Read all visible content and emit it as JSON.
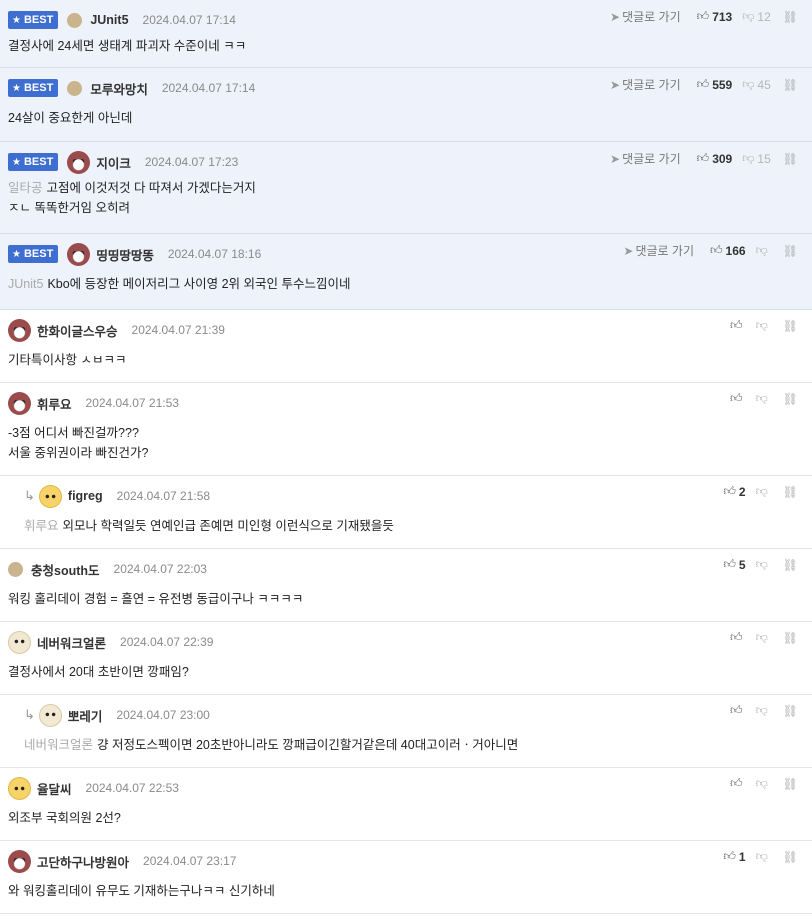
{
  "labels": {
    "best": "BEST",
    "goto": "댓글로 가기"
  },
  "comments": [
    {
      "best": true,
      "avatar": "dot",
      "nick": "JUnit5",
      "date": "2024.04.07 17:14",
      "text": [
        "결정사에 24세면 생태계 파괴자 수준이네 ㅋㅋ"
      ],
      "up": "713",
      "down": "12",
      "h": 68,
      "bodyTop": 36,
      "goto": true
    },
    {
      "best": true,
      "avatar": "dot",
      "nick": "모루와망치",
      "date": "2024.04.07 17:14",
      "text": [
        "24살이 중요한게 아닌데"
      ],
      "up": "559",
      "down": "45",
      "h": 74,
      "bodyTop": 40,
      "goto": true
    },
    {
      "best": true,
      "avatar": "dog",
      "nick": "지이크",
      "date": "2024.04.07 17:23",
      "ref": "일타공",
      "text": [
        "고점에 이것저것 다 따져서 가겠다는거지",
        "ㅈㄴ 똑똑한거임 오히려"
      ],
      "up": "309",
      "down": "15",
      "h": 92,
      "bodyTop": 36,
      "goto": true
    },
    {
      "best": true,
      "avatar": "dog",
      "nick": "띵띵땅땅똥",
      "date": "2024.04.07 18:16",
      "ref": "JUnit5",
      "text": [
        "Kbo에 등장한 메이저리그 사이영 2위 외국인 투수느낌이네"
      ],
      "up": "166",
      "down": "",
      "h": 76,
      "bodyTop": 40,
      "goto": true
    },
    {
      "best": false,
      "avatar": "dog",
      "nick": "한화이글스우승",
      "date": "2024.04.07 21:39",
      "text": [
        "기타특이사항 ㅅㅂㅋㅋ"
      ],
      "up": "",
      "down": "",
      "h": 73,
      "bodyTop": 40
    },
    {
      "best": false,
      "avatar": "dog",
      "nick": "휘루요",
      "date": "2024.04.07 21:53",
      "text": [
        "-3점 어디서 빠진걸까???",
        "서울 중위권이라 빠진건가?"
      ],
      "up": "",
      "down": "",
      "h": 93,
      "bodyTop": 40
    },
    {
      "best": false,
      "reply": true,
      "avatar": "fox",
      "nick": "figreg",
      "date": "2024.04.07 21:58",
      "ref": "휘루요",
      "text": [
        "외모나 학력일듯 연예인급 존예면 미인형 이런식으로 기재됐을듯"
      ],
      "up": "2",
      "down": "",
      "h": 73,
      "bodyTop": 40
    },
    {
      "best": false,
      "avatar": "dot",
      "nick": "충청south도",
      "date": "2024.04.07 22:03",
      "text": [
        "워킹 홀리데이 경험 = 흘연 = 유전병 동급이구나 ㅋㅋㅋㅋ"
      ],
      "up": "5",
      "down": "",
      "h": 73,
      "bodyTop": 40
    },
    {
      "best": false,
      "avatar": "pup",
      "nick": "네버워크얼론",
      "date": "2024.04.07 22:39",
      "text": [
        "결정사에서 20대 초반이면 깡패임?"
      ],
      "up": "",
      "down": "",
      "h": 73,
      "bodyTop": 40
    },
    {
      "best": false,
      "reply": true,
      "avatar": "pup",
      "nick": "뽀레기",
      "date": "2024.04.07 23:00",
      "ref": "네버워크얼론",
      "text": [
        "걍 저정도스펙이면 20초반아니라도 깡패급이긴할거같은데 40대고이러ㆍ거아니면"
      ],
      "up": "",
      "down": "",
      "h": 73,
      "bodyTop": 40
    },
    {
      "best": false,
      "avatar": "fox",
      "nick": "율달씨",
      "date": "2024.04.07 22:53",
      "text": [
        "외조부 국회의원 2선?"
      ],
      "up": "",
      "down": "",
      "h": 73,
      "bodyTop": 40
    },
    {
      "best": false,
      "avatar": "dog",
      "nick": "고단하구나방원아",
      "date": "2024.04.07 23:17",
      "text": [
        "와 워킹홀리데이 유무도 기재하는구나ㅋㅋ 신기하네"
      ],
      "up": "1",
      "down": "",
      "h": 73,
      "bodyTop": 40
    }
  ]
}
